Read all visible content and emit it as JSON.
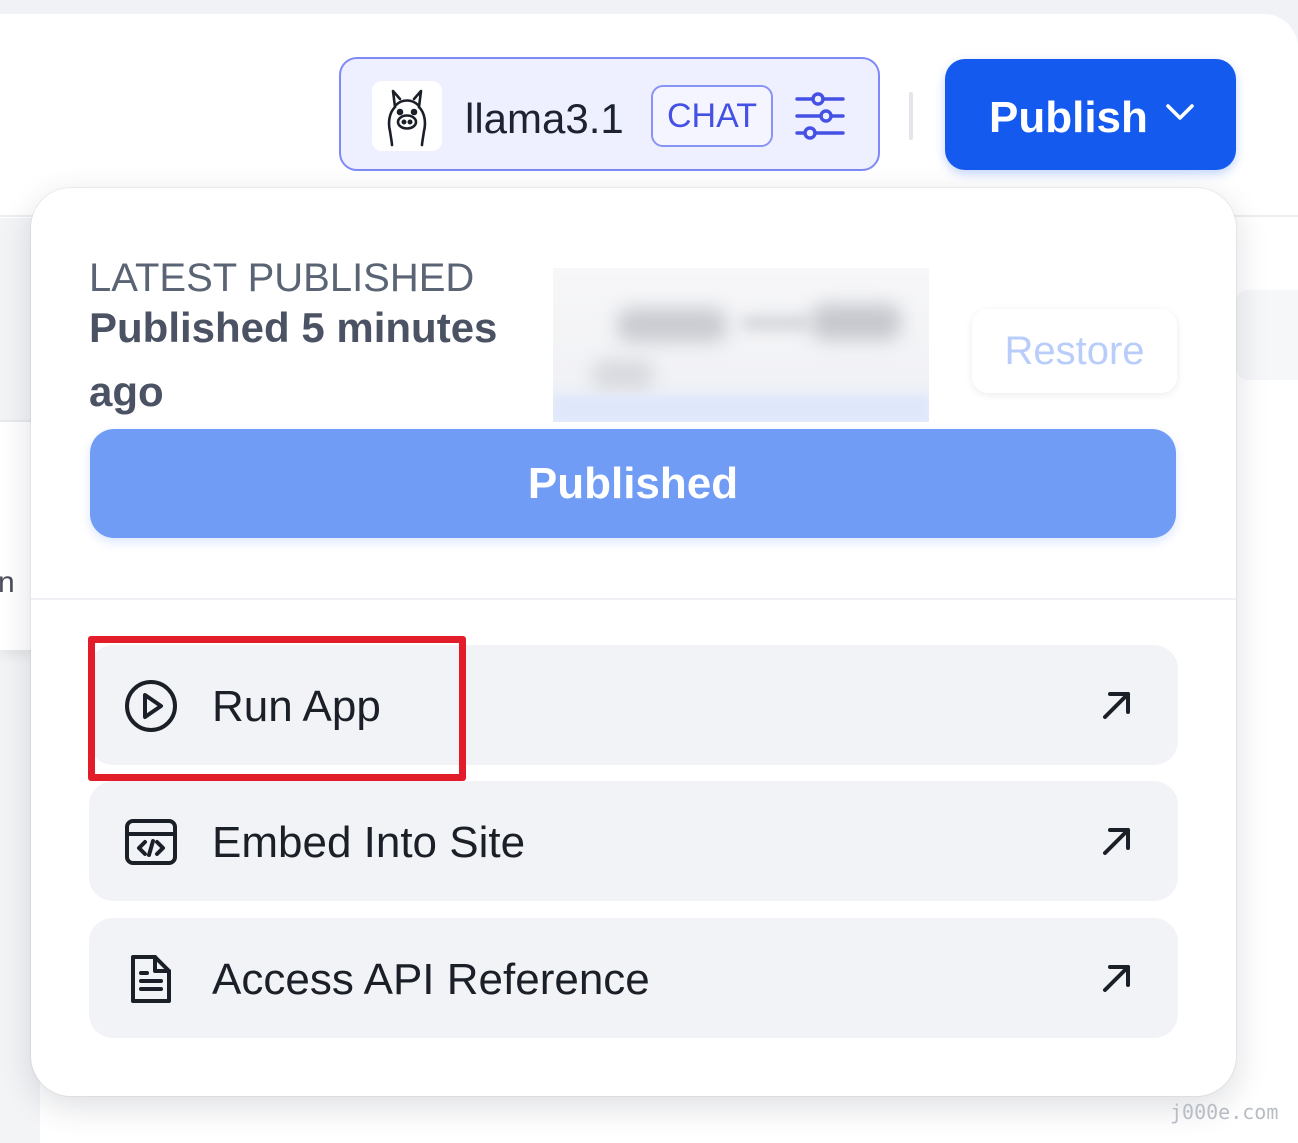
{
  "header": {
    "model": {
      "name": "llama3.1",
      "mode_badge": "CHAT",
      "avatar_icon": "llama-icon",
      "settings_icon": "sliders-icon"
    },
    "publish_button": {
      "label": "Publish",
      "icon": "chevron-down-icon"
    }
  },
  "background": {
    "partial_text": "n"
  },
  "publish_menu": {
    "section_label": "LATEST PUBLISHED",
    "published_time": "Published 5 minutes ago",
    "restore_label": "Restore",
    "published_label": "Published",
    "items": [
      {
        "label": "Run App",
        "icon": "play-circle-icon",
        "trailing_icon": "arrow-up-right-icon"
      },
      {
        "label": "Embed Into Site",
        "icon": "embed-code-icon",
        "trailing_icon": "arrow-up-right-icon"
      },
      {
        "label": "Access API Reference",
        "icon": "document-icon",
        "trailing_icon": "arrow-up-right-icon"
      }
    ]
  },
  "colors": {
    "accent": "#155aef",
    "published_button": "#709cf5",
    "highlight": "#e31c2a",
    "model_border": "#7f89f7"
  },
  "watermark": "j000e.com"
}
